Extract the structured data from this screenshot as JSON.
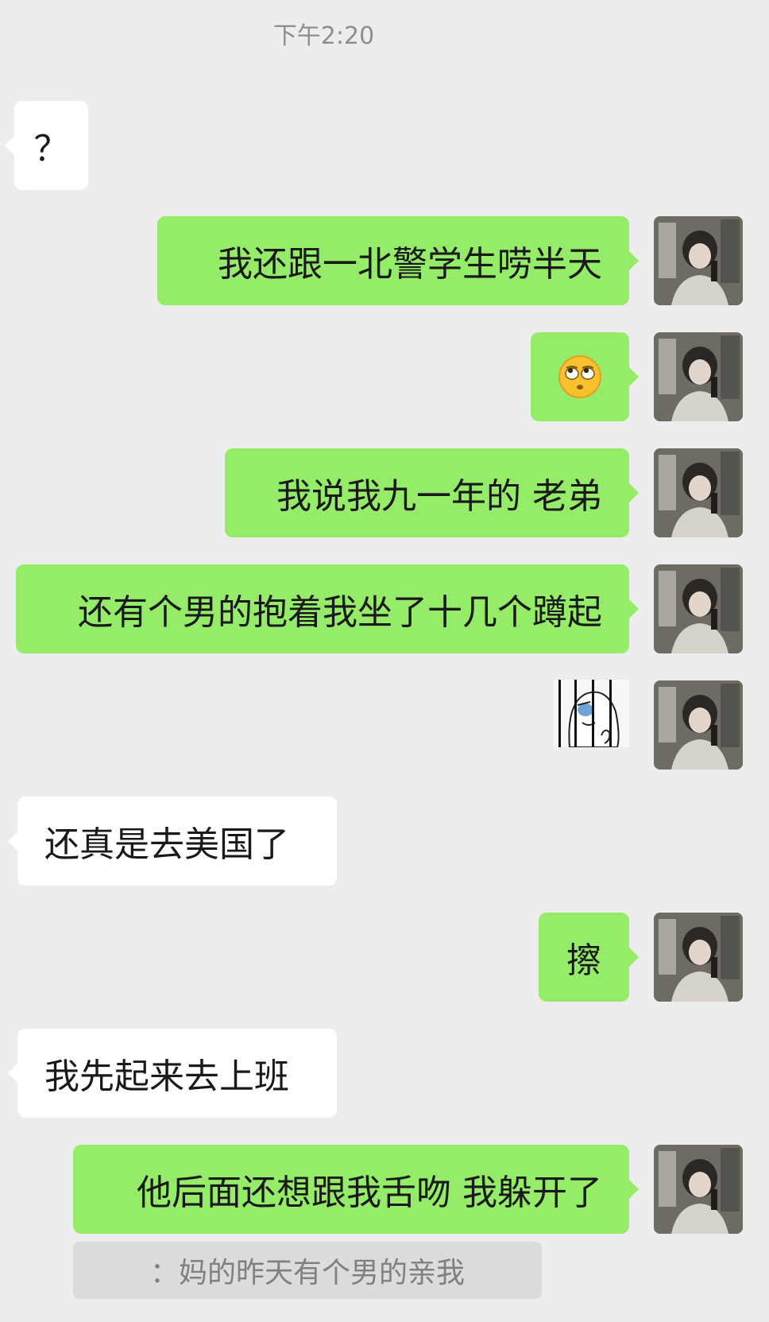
{
  "chat": {
    "timestamp": "下午2:20",
    "messages": [
      {
        "dir": "in",
        "text": "？"
      },
      {
        "dir": "out",
        "text": "我还跟一北警学生唠半天"
      },
      {
        "dir": "out",
        "type": "emoji",
        "icon": "rolling-eyes-face-icon"
      },
      {
        "dir": "out",
        "text": "我说我九一年的 老弟"
      },
      {
        "dir": "out",
        "text": "还有个男的抱着我坐了十几个蹲起"
      },
      {
        "dir": "out",
        "type": "sticker",
        "icon": "behind-bars-sticker"
      },
      {
        "dir": "in",
        "text": "还真是去美国了"
      },
      {
        "dir": "out",
        "text": "擦"
      },
      {
        "dir": "in",
        "text": "我先起来去上班"
      },
      {
        "dir": "out",
        "text": "他后面还想跟我舌吻 我躲开了"
      }
    ],
    "quote": "：妈的昨天有个男的亲我"
  },
  "colors": {
    "background": "#ededed",
    "outgoing_bubble": "#95ec69",
    "incoming_bubble": "#ffffff"
  }
}
